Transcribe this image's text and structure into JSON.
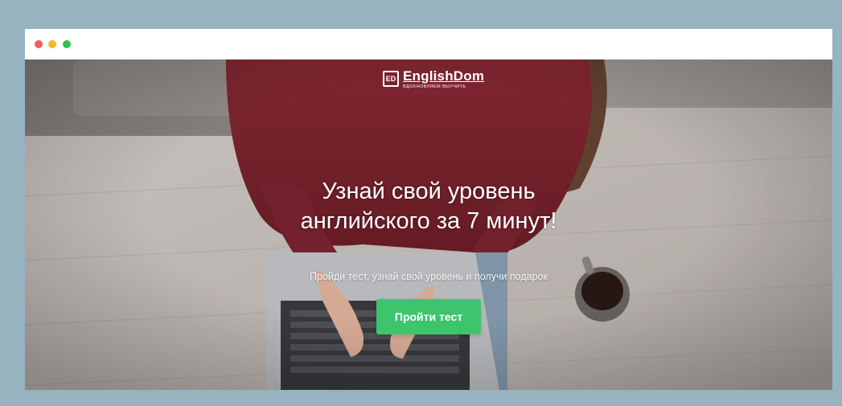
{
  "window": {
    "controls": [
      "close",
      "minimize",
      "maximize"
    ]
  },
  "brand": {
    "name": "EnglishDom",
    "mark": "ED",
    "tagline": "вдохновляем выучить"
  },
  "hero": {
    "headline_line1": "Узнай свой уровень",
    "headline_line2": "английского за 7 минут!",
    "subline": "Пройди тест, узнай свой уровень и получи подарок",
    "cta_label": "Пройти тест"
  },
  "colors": {
    "frame": "#97b3bf",
    "cta": "#3ec46d",
    "dot_red": "#f45b5b",
    "dot_yellow": "#f5b82e",
    "dot_green": "#2fc24a"
  }
}
